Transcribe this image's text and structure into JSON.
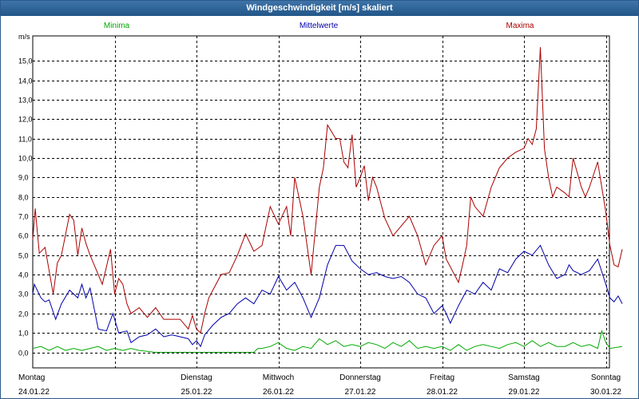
{
  "window": {
    "title": "Windgeschwindigkeit [m/s] skaliert"
  },
  "colors": {
    "titlebar": "#2b5f94",
    "minima": "#00aa00",
    "mittelwerte": "#0000aa",
    "maxima": "#aa0000"
  },
  "chart_data": {
    "type": "line",
    "title": "Windgeschwindigkeit [m/s] skaliert",
    "ylabel": "m/s",
    "xlabel": "",
    "ylim": [
      -0.8,
      16.3
    ],
    "yticks": [
      "0,0",
      "1,0",
      "2,0",
      "3,0",
      "4,0",
      "5,0",
      "6,0",
      "7,0",
      "8,0",
      "9,0",
      "10,0",
      "11,0",
      "12,0",
      "13,0",
      "14,0",
      "15,0"
    ],
    "grid": true,
    "legend": "top",
    "days": [
      {
        "weekday": "Montag",
        "date": "24.01.22"
      },
      {
        "weekday": "Dienstag",
        "date": "25.01.22"
      },
      {
        "weekday": "Mittwoch",
        "date": "26.01.22"
      },
      {
        "weekday": "Donnerstag",
        "date": "27.01.22"
      },
      {
        "weekday": "Freitag",
        "date": "28.01.22"
      },
      {
        "weekday": "Samstag",
        "date": "29.01.22"
      },
      {
        "weekday": "Sonntag",
        "date": "30.01.22"
      }
    ],
    "x_unit": "days since 24.01.22 00:00",
    "series": [
      {
        "name": "Minima",
        "color": "#00aa00",
        "points": [
          [
            0,
            0.2
          ],
          [
            0.1,
            0.3
          ],
          [
            0.2,
            0.1
          ],
          [
            0.3,
            0.3
          ],
          [
            0.4,
            0.1
          ],
          [
            0.5,
            0.2
          ],
          [
            0.6,
            0.1
          ],
          [
            0.7,
            0.2
          ],
          [
            0.8,
            0.3
          ],
          [
            0.9,
            0.1
          ],
          [
            1.0,
            0.2
          ],
          [
            1.1,
            0.1
          ],
          [
            1.2,
            0.2
          ],
          [
            1.3,
            0.1
          ],
          [
            1.5,
            0.0
          ],
          [
            1.8,
            0.0
          ],
          [
            2.0,
            0.0
          ],
          [
            2.5,
            0.0
          ],
          [
            2.7,
            0.0
          ],
          [
            2.75,
            0.2
          ],
          [
            2.8,
            0.2
          ],
          [
            2.9,
            0.3
          ],
          [
            3.0,
            0.5
          ],
          [
            3.1,
            0.2
          ],
          [
            3.2,
            0.1
          ],
          [
            3.3,
            0.3
          ],
          [
            3.4,
            0.2
          ],
          [
            3.5,
            0.7
          ],
          [
            3.6,
            0.4
          ],
          [
            3.7,
            0.6
          ],
          [
            3.8,
            0.3
          ],
          [
            3.9,
            0.4
          ],
          [
            4.0,
            0.3
          ],
          [
            4.1,
            0.5
          ],
          [
            4.2,
            0.4
          ],
          [
            4.3,
            0.2
          ],
          [
            4.4,
            0.5
          ],
          [
            4.5,
            0.3
          ],
          [
            4.6,
            0.6
          ],
          [
            4.7,
            0.2
          ],
          [
            4.8,
            0.3
          ],
          [
            4.9,
            0.2
          ],
          [
            5.0,
            0.3
          ],
          [
            5.1,
            0.1
          ],
          [
            5.2,
            0.4
          ],
          [
            5.3,
            0.1
          ],
          [
            5.4,
            0.3
          ],
          [
            5.5,
            0.4
          ],
          [
            5.6,
            0.3
          ],
          [
            5.7,
            0.2
          ],
          [
            5.8,
            0.4
          ],
          [
            5.9,
            0.5
          ],
          [
            6.0,
            0.3
          ],
          [
            6.1,
            0.6
          ],
          [
            6.2,
            0.3
          ],
          [
            6.3,
            0.5
          ],
          [
            6.4,
            0.3
          ],
          [
            6.5,
            0.3
          ],
          [
            6.6,
            0.5
          ],
          [
            6.7,
            0.3
          ],
          [
            6.8,
            0.4
          ],
          [
            6.9,
            0.2
          ],
          [
            6.95,
            1.1
          ],
          [
            7.0,
            0.5
          ],
          [
            7.05,
            0.2
          ],
          [
            7.2,
            0.3
          ]
        ]
      },
      {
        "name": "Mittelwerte",
        "color": "#0000aa",
        "points": [
          [
            0,
            3.0
          ],
          [
            0.02,
            3.5
          ],
          [
            0.1,
            2.8
          ],
          [
            0.15,
            2.6
          ],
          [
            0.2,
            2.7
          ],
          [
            0.28,
            1.7
          ],
          [
            0.35,
            2.5
          ],
          [
            0.45,
            3.2
          ],
          [
            0.55,
            2.8
          ],
          [
            0.6,
            3.5
          ],
          [
            0.65,
            2.8
          ],
          [
            0.7,
            3.3
          ],
          [
            0.8,
            1.2
          ],
          [
            0.9,
            1.1
          ],
          [
            0.98,
            2.0
          ],
          [
            1.05,
            1.0
          ],
          [
            1.15,
            1.1
          ],
          [
            1.2,
            0.5
          ],
          [
            1.3,
            0.8
          ],
          [
            1.4,
            0.9
          ],
          [
            1.5,
            1.2
          ],
          [
            1.6,
            0.8
          ],
          [
            1.7,
            0.9
          ],
          [
            1.8,
            0.8
          ],
          [
            1.9,
            0.7
          ],
          [
            1.95,
            0.4
          ],
          [
            2.0,
            0.6
          ],
          [
            2.05,
            0.3
          ],
          [
            2.1,
            0.9
          ],
          [
            2.2,
            1.4
          ],
          [
            2.3,
            1.8
          ],
          [
            2.4,
            2.0
          ],
          [
            2.5,
            2.5
          ],
          [
            2.6,
            2.8
          ],
          [
            2.7,
            2.5
          ],
          [
            2.8,
            3.2
          ],
          [
            2.9,
            3.0
          ],
          [
            3.0,
            3.9
          ],
          [
            3.1,
            3.2
          ],
          [
            3.2,
            3.6
          ],
          [
            3.3,
            2.8
          ],
          [
            3.4,
            1.8
          ],
          [
            3.5,
            2.8
          ],
          [
            3.6,
            4.5
          ],
          [
            3.7,
            5.5
          ],
          [
            3.8,
            5.5
          ],
          [
            3.9,
            4.7
          ],
          [
            4.0,
            4.3
          ],
          [
            4.1,
            4.0
          ],
          [
            4.2,
            4.1
          ],
          [
            4.3,
            3.9
          ],
          [
            4.4,
            3.8
          ],
          [
            4.5,
            3.9
          ],
          [
            4.6,
            3.6
          ],
          [
            4.7,
            3.0
          ],
          [
            4.8,
            2.8
          ],
          [
            4.9,
            2.0
          ],
          [
            5.0,
            2.4
          ],
          [
            5.05,
            2.0
          ],
          [
            5.1,
            1.5
          ],
          [
            5.2,
            2.4
          ],
          [
            5.3,
            3.2
          ],
          [
            5.4,
            3.0
          ],
          [
            5.5,
            3.6
          ],
          [
            5.6,
            3.2
          ],
          [
            5.7,
            4.3
          ],
          [
            5.8,
            4.1
          ],
          [
            5.9,
            4.8
          ],
          [
            6.0,
            5.2
          ],
          [
            6.1,
            5.0
          ],
          [
            6.2,
            5.5
          ],
          [
            6.3,
            4.5
          ],
          [
            6.4,
            3.8
          ],
          [
            6.5,
            4.0
          ],
          [
            6.55,
            4.5
          ],
          [
            6.6,
            4.2
          ],
          [
            6.7,
            4.0
          ],
          [
            6.8,
            4.2
          ],
          [
            6.9,
            4.8
          ],
          [
            7.0,
            3.5
          ],
          [
            7.05,
            2.8
          ],
          [
            7.1,
            2.6
          ],
          [
            7.15,
            2.9
          ],
          [
            7.2,
            2.5
          ]
        ]
      },
      {
        "name": "Maxima",
        "color": "#aa0000",
        "points": [
          [
            0,
            5.8
          ],
          [
            0.03,
            7.4
          ],
          [
            0.08,
            5.1
          ],
          [
            0.15,
            5.4
          ],
          [
            0.2,
            4.2
          ],
          [
            0.25,
            3.0
          ],
          [
            0.3,
            4.6
          ],
          [
            0.35,
            5.0
          ],
          [
            0.45,
            7.1
          ],
          [
            0.5,
            6.8
          ],
          [
            0.55,
            5.0
          ],
          [
            0.6,
            6.4
          ],
          [
            0.65,
            5.6
          ],
          [
            0.7,
            5.0
          ],
          [
            0.8,
            4.0
          ],
          [
            0.85,
            3.5
          ],
          [
            0.95,
            5.3
          ],
          [
            1.0,
            3.0
          ],
          [
            1.05,
            3.8
          ],
          [
            1.1,
            3.5
          ],
          [
            1.15,
            2.5
          ],
          [
            1.2,
            2.0
          ],
          [
            1.3,
            2.3
          ],
          [
            1.4,
            1.8
          ],
          [
            1.5,
            2.3
          ],
          [
            1.6,
            1.7
          ],
          [
            1.7,
            1.7
          ],
          [
            1.8,
            1.7
          ],
          [
            1.9,
            1.2
          ],
          [
            1.95,
            1.9
          ],
          [
            2.0,
            1.2
          ],
          [
            2.05,
            1.0
          ],
          [
            2.1,
            2.0
          ],
          [
            2.15,
            2.8
          ],
          [
            2.2,
            3.2
          ],
          [
            2.3,
            4.0
          ],
          [
            2.4,
            4.1
          ],
          [
            2.5,
            5.0
          ],
          [
            2.6,
            6.1
          ],
          [
            2.7,
            5.2
          ],
          [
            2.8,
            5.5
          ],
          [
            2.9,
            7.5
          ],
          [
            3.0,
            6.6
          ],
          [
            3.1,
            7.5
          ],
          [
            3.15,
            6.0
          ],
          [
            3.2,
            9.0
          ],
          [
            3.3,
            7.0
          ],
          [
            3.4,
            4.0
          ],
          [
            3.5,
            8.5
          ],
          [
            3.55,
            9.5
          ],
          [
            3.6,
            11.7
          ],
          [
            3.7,
            11.0
          ],
          [
            3.75,
            11.0
          ],
          [
            3.8,
            9.8
          ],
          [
            3.85,
            9.5
          ],
          [
            3.9,
            11.2
          ],
          [
            3.95,
            8.5
          ],
          [
            4.0,
            9.0
          ],
          [
            4.05,
            9.6
          ],
          [
            4.1,
            7.8
          ],
          [
            4.15,
            9.0
          ],
          [
            4.2,
            8.5
          ],
          [
            4.3,
            6.9
          ],
          [
            4.4,
            6.0
          ],
          [
            4.5,
            6.5
          ],
          [
            4.6,
            7.0
          ],
          [
            4.7,
            6.0
          ],
          [
            4.8,
            4.5
          ],
          [
            4.9,
            5.5
          ],
          [
            5.0,
            6.0
          ],
          [
            5.05,
            4.8
          ],
          [
            5.1,
            4.4
          ],
          [
            5.2,
            3.6
          ],
          [
            5.25,
            4.5
          ],
          [
            5.3,
            5.5
          ],
          [
            5.35,
            8.0
          ],
          [
            5.4,
            7.5
          ],
          [
            5.5,
            7.0
          ],
          [
            5.6,
            8.5
          ],
          [
            5.7,
            9.5
          ],
          [
            5.8,
            10.0
          ],
          [
            5.9,
            10.3
          ],
          [
            6.0,
            10.5
          ],
          [
            6.05,
            11.0
          ],
          [
            6.1,
            10.7
          ],
          [
            6.15,
            11.5
          ],
          [
            6.2,
            15.7
          ],
          [
            6.25,
            10.5
          ],
          [
            6.3,
            9.0
          ],
          [
            6.35,
            8.0
          ],
          [
            6.4,
            8.5
          ],
          [
            6.5,
            8.2
          ],
          [
            6.55,
            8.0
          ],
          [
            6.6,
            10.0
          ],
          [
            6.7,
            8.5
          ],
          [
            6.75,
            8.0
          ],
          [
            6.8,
            8.5
          ],
          [
            6.9,
            9.8
          ],
          [
            7.0,
            7.2
          ],
          [
            7.05,
            5.5
          ],
          [
            7.1,
            4.5
          ],
          [
            7.15,
            4.4
          ],
          [
            7.2,
            5.3
          ]
        ]
      }
    ]
  }
}
